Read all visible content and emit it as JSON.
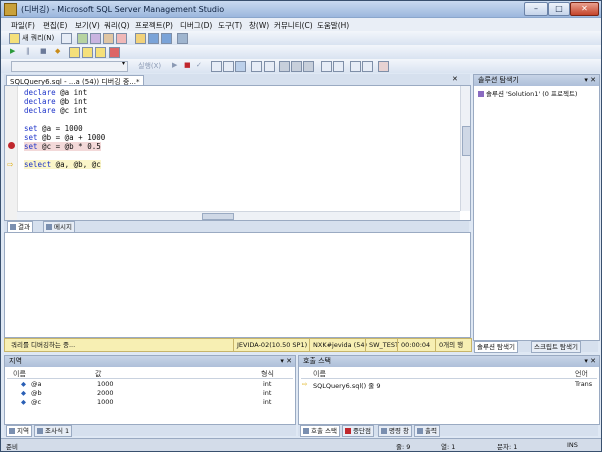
{
  "window": {
    "title": "(디버깅) - Microsoft SQL Server Management Studio",
    "controls": [
      "–",
      "□",
      "✕"
    ]
  },
  "menu": [
    "파일(F)",
    "편집(E)",
    "보기(V)",
    "쿼리(Q)",
    "프로젝트(P)",
    "디버그(D)",
    "도구(T)",
    "창(W)",
    "커뮤니티(C)",
    "도움말(H)"
  ],
  "toolbar": {
    "new_query": "새 쿼리(N)",
    "debug_run": "실행(X)"
  },
  "editor": {
    "tab_label": "SQLQuery6.sql - ...a (54)) 디버깅 중...*",
    "lines": [
      {
        "kw": "declare",
        "rest": " @a int"
      },
      {
        "kw": "declare",
        "rest": " @b int"
      },
      {
        "kw": "declare",
        "rest": " @c int"
      },
      {
        "kw": "",
        "rest": ""
      },
      {
        "kw": "set",
        "rest": " @a = 1000"
      },
      {
        "kw": "set",
        "rest": " @b = @a + 1000"
      },
      {
        "kw": "set",
        "rest": " @c = @b * 0.5"
      },
      {
        "kw": "",
        "rest": ""
      },
      {
        "kw": "select",
        "rest": " @a, @b, @c"
      }
    ]
  },
  "results": {
    "tabs": [
      "결과",
      "메시지"
    ]
  },
  "solution": {
    "title": "솔루션 탐색기",
    "root": "솔루션 'Solution1' (0 프로젝트)",
    "bottom_tabs": [
      "솔루션 탐색기",
      "스크립트 탐색기"
    ]
  },
  "status_bar": {
    "message": "쿼리를 디버깅하는 중...",
    "server": "JEVIDA-02(10.50 SP1)",
    "user": "NXK#jevida (54)",
    "db": "SW_TEST",
    "time": "00:00:04",
    "rows": "0개의 행"
  },
  "locals": {
    "title": "지역",
    "headers": [
      "이름",
      "값",
      "형식"
    ],
    "rows": [
      {
        "name": "@a",
        "value": "1000",
        "type": "int"
      },
      {
        "name": "@b",
        "value": "2000",
        "type": "int"
      },
      {
        "name": "@c",
        "value": "1000",
        "type": "int"
      }
    ],
    "tabs": [
      "지역",
      "조사식 1"
    ]
  },
  "callstack": {
    "title": "호출 스택",
    "headers": [
      "이름",
      "언어"
    ],
    "rows": [
      {
        "name": "SQLQuery6.sql() 줄 9",
        "lang": "Trans"
      }
    ],
    "tabs": [
      "호출 스택",
      "중단점",
      "명령 창",
      "출력"
    ]
  },
  "bottom_status": {
    "ready": "준비",
    "line": "줄: 9",
    "col": "열: 1",
    "ch": "문자: 1",
    "ins": "INS"
  },
  "colors": {
    "keyword": "#1d33c9",
    "status_yellow": "#f7efb3",
    "breakpoint": "#c0272d",
    "current_line_arrow": "#f1c232"
  }
}
